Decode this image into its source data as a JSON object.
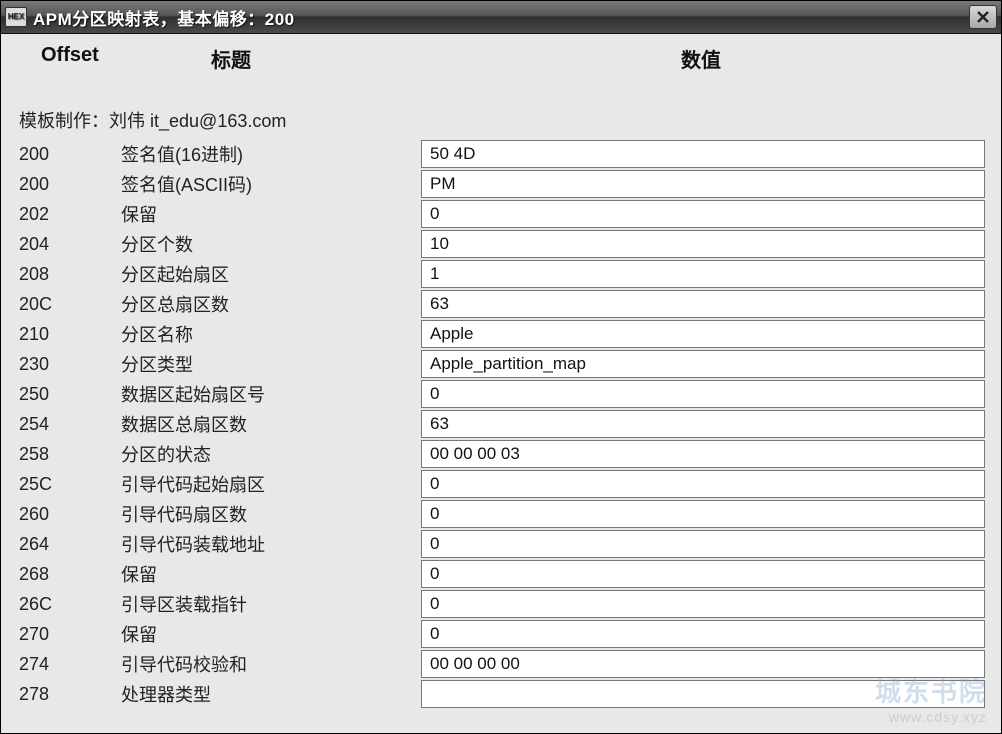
{
  "window": {
    "title": "APM分区映射表，基本偏移：200",
    "app_icon_label": "HEX"
  },
  "headers": {
    "offset": "Offset",
    "title": "标题",
    "value": "数值"
  },
  "credit": "模板制作：刘伟  it_edu@163.com",
  "rows": [
    {
      "offset": "200",
      "title": "签名值(16进制)",
      "value": "50 4D"
    },
    {
      "offset": "200",
      "title": "签名值(ASCII码)",
      "value": "PM"
    },
    {
      "offset": "202",
      "title": "保留",
      "value": "0"
    },
    {
      "offset": "204",
      "title": "分区个数",
      "value": "10"
    },
    {
      "offset": "208",
      "title": "分区起始扇区",
      "value": "1"
    },
    {
      "offset": "20C",
      "title": "分区总扇区数",
      "value": "63"
    },
    {
      "offset": "210",
      "title": "分区名称",
      "value": "Apple"
    },
    {
      "offset": "230",
      "title": "分区类型",
      "value": "Apple_partition_map"
    },
    {
      "offset": "250",
      "title": "数据区起始扇区号",
      "value": "0"
    },
    {
      "offset": "254",
      "title": "数据区总扇区数",
      "value": "63"
    },
    {
      "offset": "258",
      "title": "分区的状态",
      "value": "00 00 00 03"
    },
    {
      "offset": "25C",
      "title": "引导代码起始扇区",
      "value": "0"
    },
    {
      "offset": "260",
      "title": "引导代码扇区数",
      "value": "0"
    },
    {
      "offset": "264",
      "title": "引导代码装载地址",
      "value": "0"
    },
    {
      "offset": "268",
      "title": "保留",
      "value": "0"
    },
    {
      "offset": "26C",
      "title": "引导区装载指针",
      "value": "0"
    },
    {
      "offset": "270",
      "title": "保留",
      "value": "0"
    },
    {
      "offset": "274",
      "title": "引导代码校验和",
      "value": "00 00 00 00"
    },
    {
      "offset": "278",
      "title": "处理器类型",
      "value": ""
    }
  ],
  "watermark": {
    "line1": "城东书院",
    "line2": "www.cdsy.xyz"
  }
}
